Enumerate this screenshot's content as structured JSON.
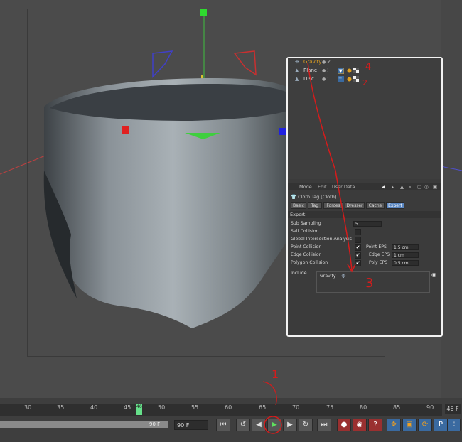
{
  "object_manager": {
    "objects": [
      {
        "name": "Gravity",
        "color": "#e0a020"
      },
      {
        "name": "Plane",
        "color": "#d8d8d8"
      },
      {
        "name": "Disc",
        "color": "#d8d8d8"
      }
    ]
  },
  "attributes": {
    "menu": [
      "Mode",
      "Edit",
      "User Data"
    ],
    "title": "Cloth Tag [Cloth]",
    "tabs": [
      "Basic",
      "Tag",
      "Forces",
      "Dresser",
      "Cache",
      "Expert"
    ],
    "active_tab": "Expert",
    "section": "Expert",
    "sub_sampling": {
      "label": "Sub Sampling",
      "value": "5"
    },
    "self_collision": {
      "label": "Self Collision",
      "checked": false
    },
    "global_intersection": {
      "label": "Global Intersection Analysis",
      "checked": false
    },
    "point_collision": {
      "label": "Point Collision",
      "checked": true,
      "eps_label": "Point EPS",
      "eps_value": "1.5 cm"
    },
    "edge_collision": {
      "label": "Edge Collision",
      "checked": true,
      "eps_label": "Edge EPS",
      "eps_value": "1 cm"
    },
    "polygon_collision": {
      "label": "Polygon Collision",
      "checked": true,
      "eps_label": "Poly EPS",
      "eps_value": "0.5 cm"
    },
    "include": {
      "label": "Include",
      "item": "Gravity"
    }
  },
  "timeline": {
    "ticks": [
      "30",
      "35",
      "40",
      "45",
      "50",
      "55",
      "60",
      "65",
      "70",
      "75",
      "80",
      "85",
      "90"
    ],
    "current_frame": "46",
    "end_frame": "46 F",
    "scrub_label": "90 F",
    "max_frame": "90 F"
  },
  "annotations": {
    "one": "1",
    "two": "2",
    "three": "3",
    "four": "4"
  },
  "colors": {
    "accent": "#5a86c0",
    "annotation": "#d41c1c",
    "playhead": "#66e08a"
  }
}
